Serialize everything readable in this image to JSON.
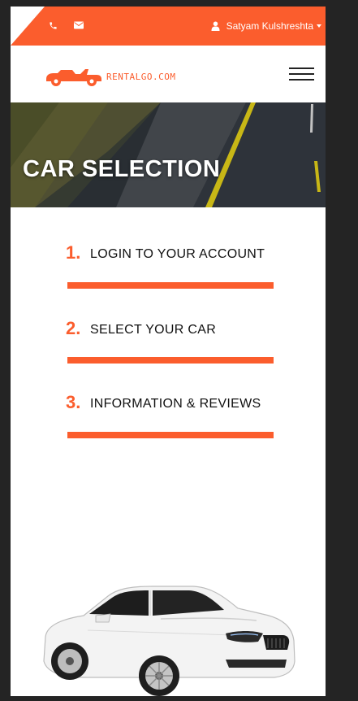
{
  "topbar": {
    "phone_icon": "phone-icon",
    "mail_icon": "envelope-icon",
    "user_icon": "user-icon",
    "user_name": "Satyam Kulshreshta",
    "accent": "#fb5d2d"
  },
  "navbar": {
    "logo_text": "RENTALGO.COM",
    "logo_icon": "car-logo-icon",
    "menu_icon": "hamburger-icon"
  },
  "hero": {
    "title": "CAR SELECTION"
  },
  "steps": [
    {
      "number": "1.",
      "label": "LOGIN TO YOUR ACCOUNT"
    },
    {
      "number": "2.",
      "label": "SELECT YOUR CAR"
    },
    {
      "number": "3.",
      "label": "INFORMATION & REVIEWS"
    }
  ]
}
